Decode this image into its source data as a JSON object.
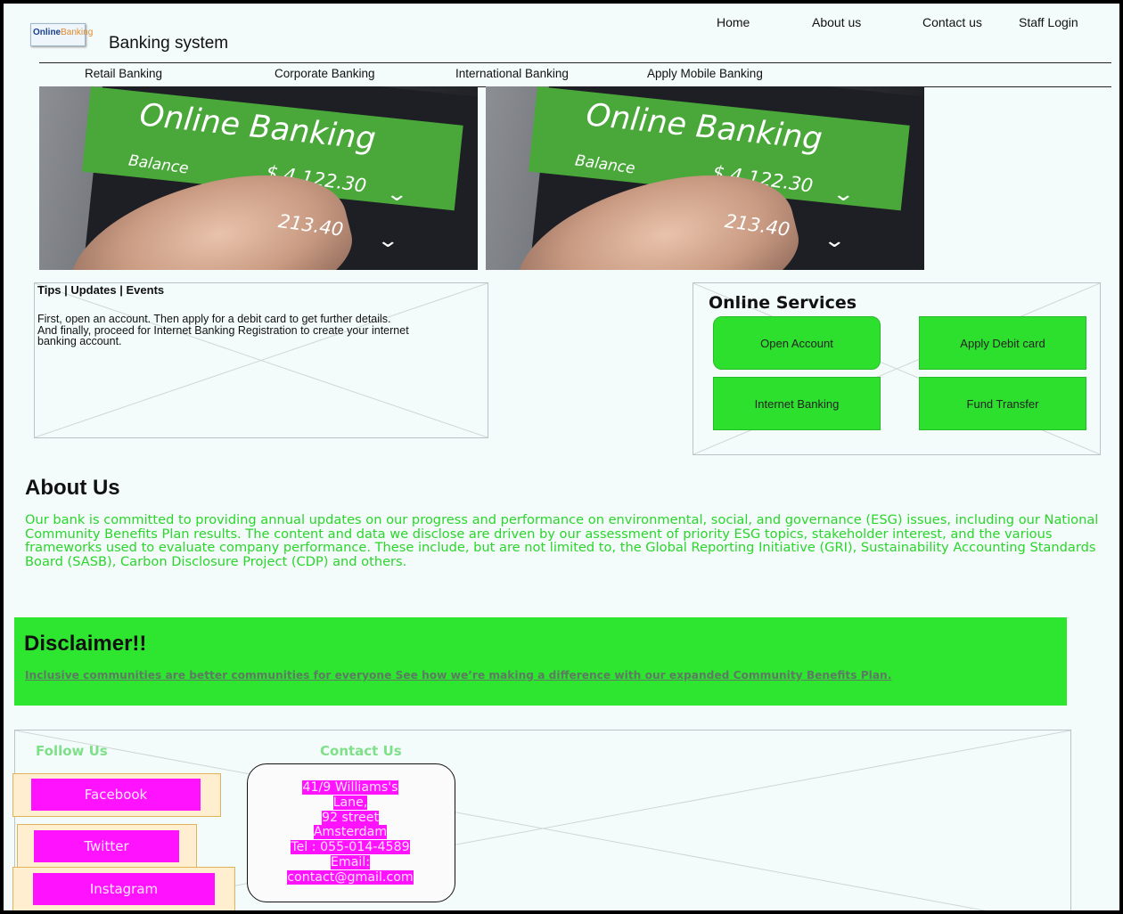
{
  "header": {
    "logo": {
      "word1": "Online",
      "word2": "Banking"
    },
    "title": "Banking system",
    "top_nav": [
      "Home",
      "About us",
      "Contact us",
      "Staff Login"
    ],
    "sub_nav": [
      "Retail Banking",
      "Corporate Banking",
      "International Banking",
      "Apply Mobile Banking"
    ]
  },
  "hero": {
    "heading": "Online Banking",
    "balance_label": "Balance",
    "amount": "$ 4,122.30",
    "amount2": "213.40"
  },
  "tips": {
    "title": "Tips | Updates | Events",
    "text": "First, open an account. Then apply for a debit card to get further details.\nAnd finally, proceed for Internet Banking Registration to create your internet banking account."
  },
  "services": {
    "title": "Online Services",
    "buttons": [
      "Open Account",
      "Apply Debit card",
      "Internet Banking",
      "Fund Transfer"
    ]
  },
  "about": {
    "heading": "About Us",
    "text": "Our bank is committed to providing annual updates on our progress and performance on environmental, social, and governance (ESG) issues, including our National Community Benefits Plan results. The content and data we disclose are driven by our assessment of priority ESG topics, stakeholder interest, and the various frameworks used to evaluate company performance. These include, but are not limited to, the Global Reporting Initiative (GRI), Sustainability Accounting Standards Board (SASB), Carbon Disclosure Project (CDP) and others."
  },
  "disclaimer": {
    "heading": "Disclaimer!!",
    "text": "Inclusive communities are better communities for everyone See how we’re making a difference with our expanded Community Benefits Plan."
  },
  "footer": {
    "follow_title": "Follow Us",
    "contact_title": "Contact Us",
    "social": [
      "Facebook",
      "Twitter",
      "Instagram"
    ],
    "contact_lines": [
      "41/9 Williams's",
      "Lane,",
      "92 street",
      "Amsterdam",
      "Tel : 055-014-4589",
      "Email:",
      "contact@gmail.com"
    ]
  },
  "colors": {
    "accent_green": "#2ee630",
    "text_green": "#2bd52b",
    "magenta": "#ff13ff"
  }
}
